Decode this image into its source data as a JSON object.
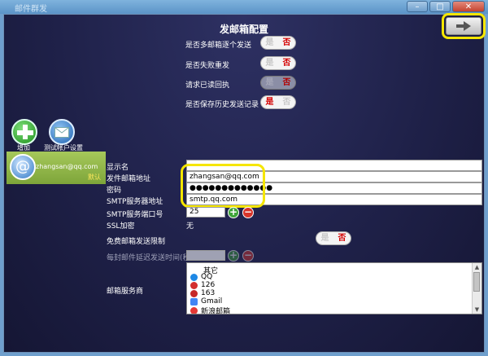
{
  "window": {
    "title": "邮件群发",
    "minimize": "–",
    "maximize": "□",
    "close": "✕"
  },
  "page": {
    "title": "发邮箱配置"
  },
  "next_button": {
    "icon": "arrow-right-icon"
  },
  "options": [
    {
      "label": "是否多邮箱逐个发送",
      "yes": "是",
      "no": "否",
      "state": "no"
    },
    {
      "label": "是否失败重发",
      "yes": "是",
      "no": "否",
      "state": "no"
    },
    {
      "label": "请求已读回执",
      "yes": "是",
      "no": "否",
      "state": "no",
      "disabled": true
    },
    {
      "label": "是否保存历史发送记录",
      "yes": "是",
      "no": "否",
      "state": "yes"
    }
  ],
  "sidebar": {
    "add_label": "增加",
    "test_label": "测试帐户设置",
    "account": {
      "email": "zhangsan@qq.com",
      "default_label": "默认"
    }
  },
  "form": {
    "display_name": {
      "label": "显示名",
      "value": ""
    },
    "sender_email": {
      "label": "发件邮箱地址",
      "value": "zhangsan@qq.com"
    },
    "password": {
      "label": "密码",
      "value": "●●●●●●●●●●●●●"
    },
    "smtp_server": {
      "label": "SMTP服务器地址",
      "value": "smtp.qq.com"
    },
    "smtp_port": {
      "label": "SMTP服务端口号",
      "value": "25"
    },
    "ssl": {
      "label": "SSL加密",
      "value": "无"
    },
    "free_limit": {
      "label": "免费邮箱发送限制",
      "yes": "是",
      "no": "否"
    },
    "delay": {
      "label": "每封邮件延迟发送时间(秒)",
      "value": ""
    },
    "provider": {
      "label": "邮箱服务商",
      "options": [
        {
          "name": "其它",
          "icon": ""
        },
        {
          "name": "QQ",
          "icon": "qq-icon",
          "color": "#1e88e5"
        },
        {
          "name": "126",
          "icon": "126-icon",
          "color": "#d32f2f"
        },
        {
          "name": "163",
          "icon": "163-icon",
          "color": "#c62828"
        },
        {
          "name": "Gmail",
          "icon": "gmail-icon",
          "color": "#4285f4"
        },
        {
          "name": "新浪邮箱",
          "icon": "sina-icon",
          "color": "#e53935"
        }
      ]
    }
  }
}
